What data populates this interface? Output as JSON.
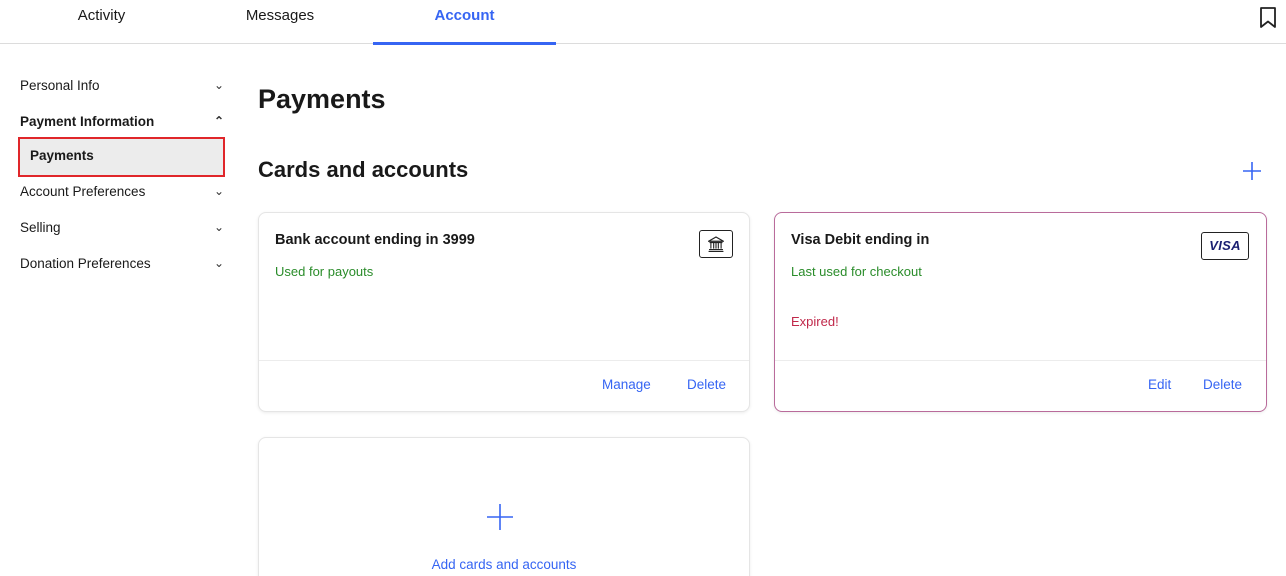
{
  "tabs": [
    {
      "label": "Activity",
      "active": false
    },
    {
      "label": "Messages",
      "active": false
    },
    {
      "label": "Account",
      "active": true
    }
  ],
  "icons": {
    "bookmark": "bookmark-icon",
    "chevron_down": "chevron-down-icon",
    "chevron_up": "chevron-up-icon",
    "plus": "plus-icon",
    "bank": "bank-icon",
    "visa": "visa-logo"
  },
  "sidebar": {
    "items": [
      {
        "label": "Personal Info",
        "chevron": "⌄"
      },
      {
        "label": "Payment Information",
        "chevron": "⌃"
      },
      {
        "label": "Payments"
      },
      {
        "label": "Account Preferences",
        "chevron": "⌄"
      },
      {
        "label": "Selling",
        "chevron": "⌄"
      },
      {
        "label": "Donation Preferences",
        "chevron": "⌄"
      }
    ]
  },
  "main": {
    "title": "Payments",
    "section_title": "Cards and accounts",
    "cards": [
      {
        "title": "Bank account ending in 3999",
        "subtitle": "Used for payouts",
        "actions": [
          "Manage",
          "Delete"
        ]
      },
      {
        "title": "Visa Debit ending in",
        "subtitle": "Last used for checkout",
        "warning": "Expired!",
        "brand": "VISA",
        "actions": [
          "Edit",
          "Delete"
        ]
      }
    ],
    "add_card_label": "Add cards and accounts"
  },
  "colors": {
    "accent": "#3665f3",
    "success_text": "#2a8c2a",
    "error_text": "#c0284a",
    "highlight_border": "#e0262a",
    "expired_card_border": "#b96b9b"
  }
}
